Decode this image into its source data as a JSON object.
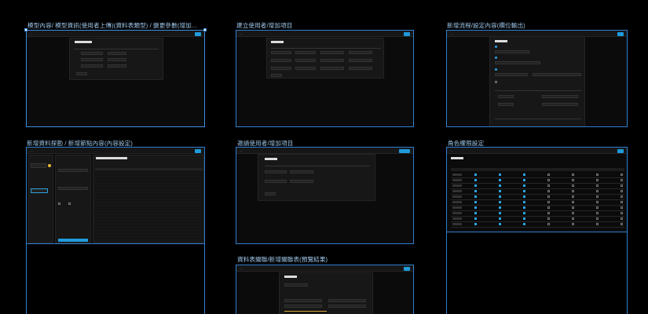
{
  "frames": [
    {
      "id": "model",
      "title": "模型內容/ 模型資訊(使用者上傳)(資料表類型) / 變更參數(增加..."
    },
    {
      "id": "create-user",
      "title": "建立使用者/增加項目"
    },
    {
      "id": "flow",
      "title": "新增流程/設定內容(欄位輸出)"
    },
    {
      "id": "data-probe",
      "title": "新增資料探勘 / 新增節點內容(內容設定)"
    },
    {
      "id": "invite-user",
      "title": "邀請使用者/增加項目"
    },
    {
      "id": "role",
      "title": "角色權限設定"
    },
    {
      "id": "relation",
      "title": "資料表關聯/新增關聯表(預覽結果)"
    }
  ]
}
